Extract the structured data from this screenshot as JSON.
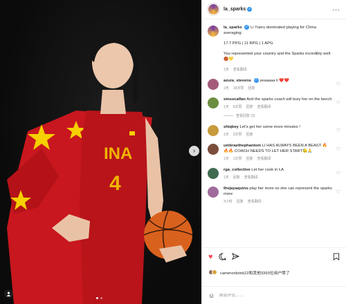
{
  "post": {
    "handle": "la_sparks",
    "more_icon": "more-horizontal-icon"
  },
  "caption": {
    "handle": "la_sparks",
    "line1": "Li Yueru dominated playing for China averaging:",
    "line2": "17.7 PPG | 11 RPG | 1 APG",
    "line3": "You represented your country and the Sparks incredibly well. 🏀💛",
    "time": "1天",
    "translate": "查看翻译"
  },
  "comments": [
    {
      "user": "azura_stevens",
      "verified": true,
      "text": "yeaaaaa li ❤️❤️",
      "time": "1天",
      "likes": "18次赞",
      "reply": "回复",
      "translate": "",
      "avatar_color": "#a45b7a"
    },
    {
      "user": "sinsocalfan",
      "verified": false,
      "text": "And the sparks coach will bury her on the bench",
      "time": "1天",
      "likes": "6次赞",
      "reply": "回复",
      "translate": "查看翻译",
      "avatar_color": "#6b8e3e"
    },
    {
      "user": "shiqbey",
      "verified": false,
      "text": "Let's get her some more minutes !",
      "time": "1天",
      "likes": "3次赞",
      "reply": "回复",
      "translate": "",
      "avatar_color": "#c79a3b"
    },
    {
      "user": "umbraethephantom",
      "verified": false,
      "text": "LI HAS ALWAYS BEEN A BEAST 🔥🔥🔥 COACH NEEDS TO LET HER START😓🙏",
      "time": "1天",
      "likes": "1次赞",
      "reply": "回复",
      "translate": "查看翻译",
      "avatar_color": "#7a4e3a"
    },
    {
      "user": "rga_collective",
      "verified": false,
      "text": "Let her cook in LA",
      "time": "1天",
      "likes": "",
      "reply": "回复",
      "translate": "查看翻译",
      "avatar_color": "#3f6b50"
    },
    {
      "user": "thejayaquino",
      "verified": false,
      "text": "play her more so she can represent the sparks more",
      "time": "3小时",
      "likes": "",
      "reply": "回复",
      "translate": "查看翻译",
      "avatar_color": "#a06b9a"
    }
  ],
  "view_replies": "查看回复 (3)",
  "liked_by": "cameronbrink22和其他3393位用户赞了",
  "add_comment_placeholder": "添加评论……",
  "colors": {
    "like": "#ed4956",
    "verified": "#3897f0",
    "jersey": "#c4161c",
    "accent_yellow": "#f6d000"
  }
}
